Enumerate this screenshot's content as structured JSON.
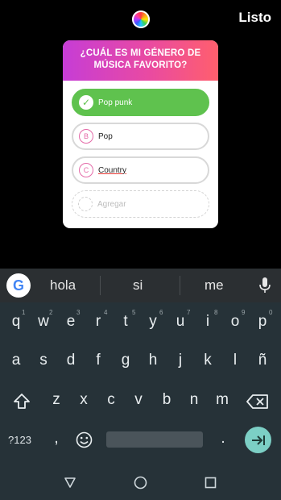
{
  "top": {
    "done_label": "Listo"
  },
  "quiz": {
    "question": "¿CUÁL ES MI GÉNERO DE MÚSICA FAVORITO?",
    "options": [
      {
        "letter": "",
        "text": "Pop punk",
        "state": "correct"
      },
      {
        "letter": "B",
        "text": "Pop",
        "state": "normal"
      },
      {
        "letter": "C",
        "text": "Country",
        "state": "normal"
      },
      {
        "letter": "",
        "text": "Agregar",
        "state": "add"
      }
    ],
    "colors": {
      "header_start": "#c63dd6",
      "header_end": "#ff5f6d",
      "correct": "#5fc24e"
    }
  },
  "suggestions": {
    "items": [
      "hola",
      "si",
      "me"
    ]
  },
  "keyboard": {
    "row1": [
      "q",
      "w",
      "e",
      "r",
      "t",
      "y",
      "u",
      "i",
      "o",
      "p"
    ],
    "row1_hints": [
      "1",
      "2",
      "3",
      "4",
      "5",
      "6",
      "7",
      "8",
      "9",
      "0"
    ],
    "row2": [
      "a",
      "s",
      "d",
      "f",
      "g",
      "h",
      "j",
      "k",
      "l",
      "ñ"
    ],
    "row3": [
      "z",
      "x",
      "c",
      "v",
      "b",
      "n",
      "m"
    ],
    "symbols_label": "?123",
    "comma": ",",
    "period": "."
  },
  "nav": {
    "icons": [
      "back-icon",
      "home-icon",
      "recents-icon"
    ]
  }
}
